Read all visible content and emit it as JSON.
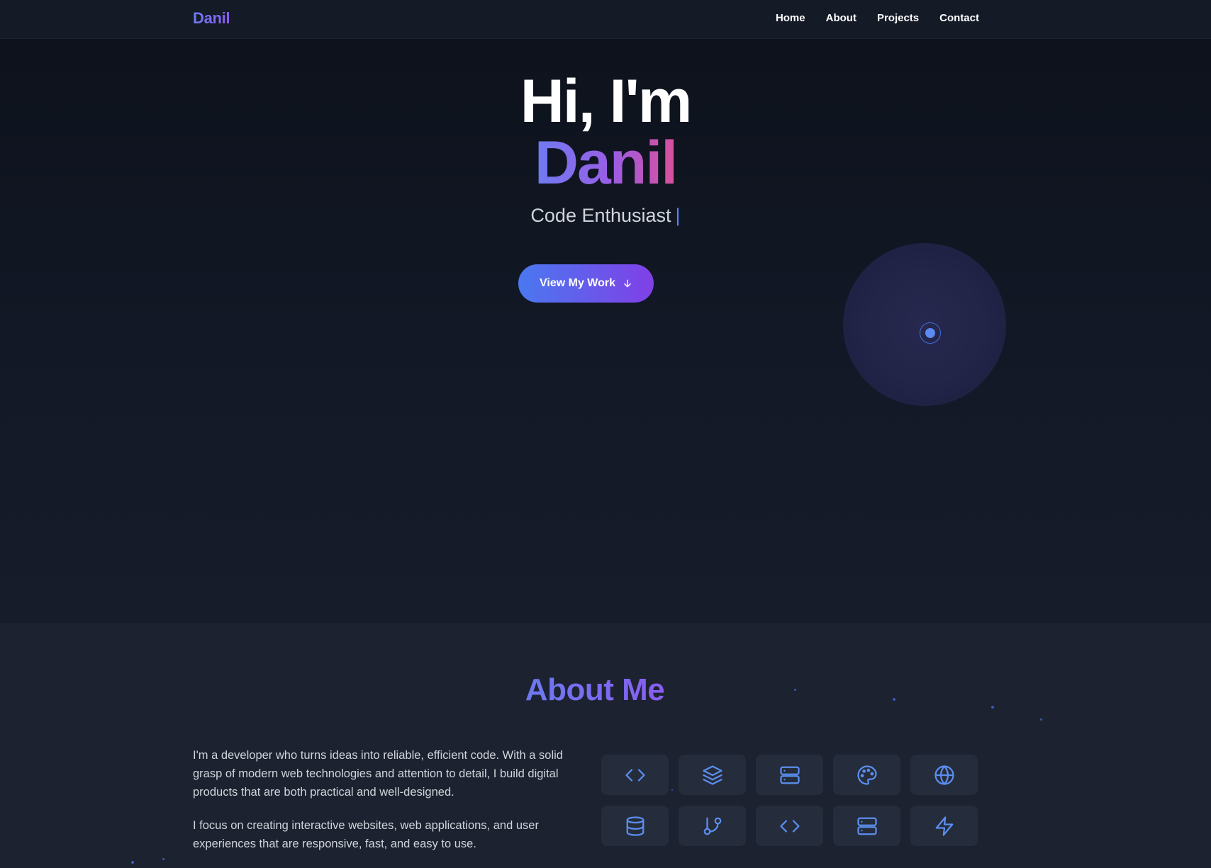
{
  "nav": {
    "brand": "Danil",
    "links": [
      {
        "label": "Home"
      },
      {
        "label": "About"
      },
      {
        "label": "Projects"
      },
      {
        "label": "Contact"
      }
    ]
  },
  "hero": {
    "greeting": "Hi, I'm",
    "name": "Danil",
    "tagline": "Code Enthusiast",
    "cursor": "|",
    "cta_label": "View My Work",
    "cta_icon": "arrow-down-icon"
  },
  "about": {
    "title": "About Me",
    "paragraphs": [
      "I'm a developer who turns ideas into reliable, efficient code. With a solid grasp of modern web technologies and attention to detail, I build digital products that are both practical and well-designed.",
      "I focus on creating interactive websites, web applications, and user experiences that are responsive, fast, and easy to use."
    ],
    "skill_icons": [
      "code-icon",
      "layers-icon",
      "server-icon",
      "palette-icon",
      "globe-icon",
      "database-icon",
      "git-branch-icon",
      "code-icon",
      "server-icon",
      "zap-icon"
    ]
  },
  "colors": {
    "accent_blue": "#5b8ef0",
    "accent_purple": "#8b5cf6",
    "accent_pink": "#db4f9a",
    "background": "#0f1420",
    "section_bg": "#1c2230"
  }
}
